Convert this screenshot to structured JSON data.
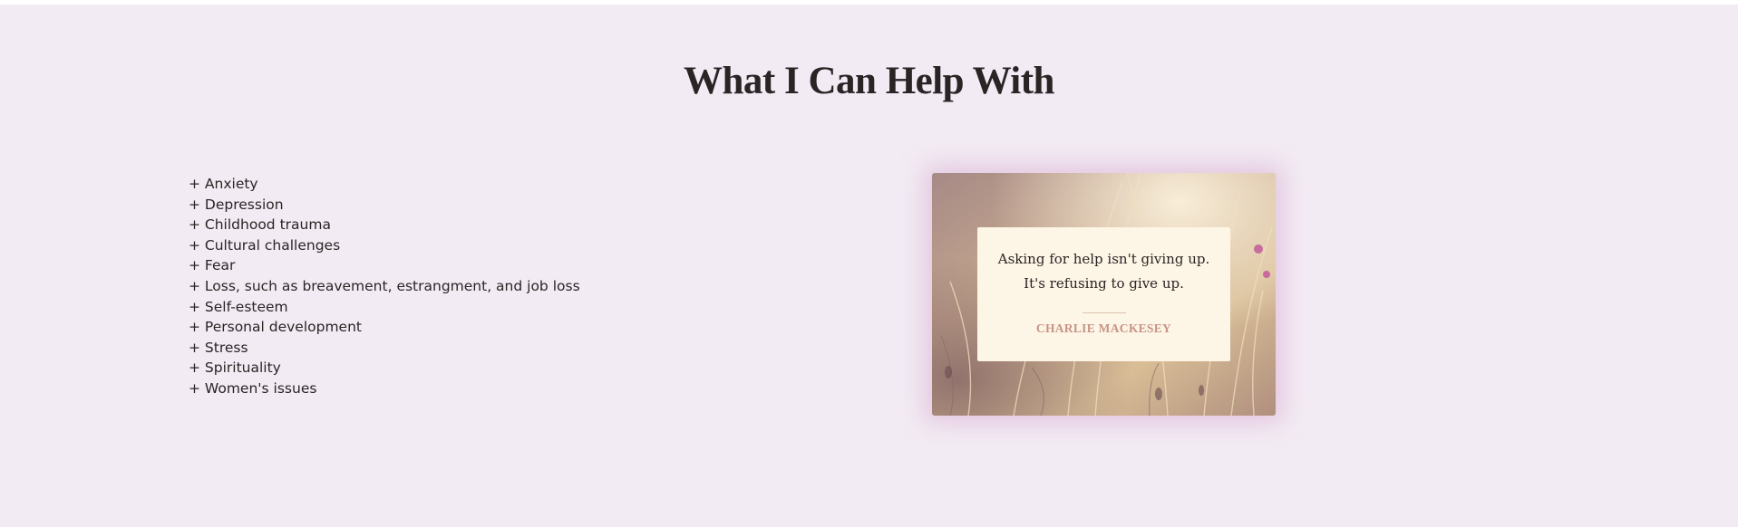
{
  "section": {
    "title": "What I Can Help With"
  },
  "topics": [
    "+ Anxiety",
    "+ Depression",
    "+ Childhood trauma",
    "+ Cultural challenges",
    "+ Fear",
    "+ Loss, such as breavement, estrangment, and job loss",
    "+ Self-esteem",
    "+ Personal development",
    "+ Stress",
    "+ Spirituality",
    "+ Women's issues"
  ],
  "quote": {
    "line1": "Asking for help isn't giving up.",
    "line2": "It's refusing to give up.",
    "author": "CHARLIE MACKESEY"
  },
  "colors": {
    "page_background": "#f3ebf4",
    "heading_text": "#2a2424",
    "quote_box": "#fdf5e5",
    "author_accent": "#c89486",
    "card_glow": "#d6aacd"
  }
}
